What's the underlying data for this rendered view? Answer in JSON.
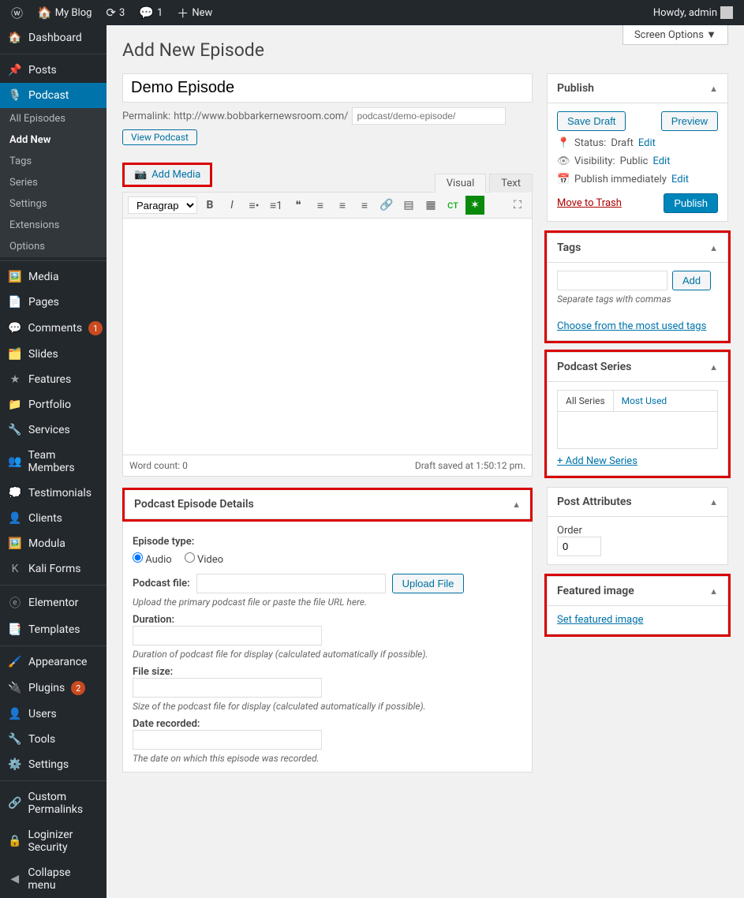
{
  "toolbar": {
    "site": "My Blog",
    "updates": "3",
    "comments": "1",
    "new": "New",
    "howdy": "Howdy, admin"
  },
  "screen_options": "Screen Options ▼",
  "page_title": "Add New Episode",
  "sidebar": {
    "items": [
      {
        "icon": "🏠",
        "label": "Dashboard"
      },
      {
        "icon": "📌",
        "label": "Posts"
      },
      {
        "icon": "🎙️",
        "label": "Podcast",
        "current": true
      },
      {
        "icon": "🖼️",
        "label": "Media"
      },
      {
        "icon": "📄",
        "label": "Pages"
      },
      {
        "icon": "💬",
        "label": "Comments",
        "badge": "1"
      },
      {
        "icon": "🗂️",
        "label": "Slides"
      },
      {
        "icon": "★",
        "label": "Features"
      },
      {
        "icon": "📁",
        "label": "Portfolio"
      },
      {
        "icon": "🔧",
        "label": "Services"
      },
      {
        "icon": "👥",
        "label": "Team Members"
      },
      {
        "icon": "💭",
        "label": "Testimonials"
      },
      {
        "icon": "👤",
        "label": "Clients"
      },
      {
        "icon": "🖼️",
        "label": "Modula"
      },
      {
        "icon": "K",
        "label": "Kali Forms"
      },
      {
        "icon": "ⓔ",
        "label": "Elementor"
      },
      {
        "icon": "📑",
        "label": "Templates"
      },
      {
        "icon": "🖌️",
        "label": "Appearance"
      },
      {
        "icon": "🔌",
        "label": "Plugins",
        "badge": "2"
      },
      {
        "icon": "👤",
        "label": "Users"
      },
      {
        "icon": "🔧",
        "label": "Tools"
      },
      {
        "icon": "⚙️",
        "label": "Settings"
      },
      {
        "icon": "🔗",
        "label": "Custom Permalinks"
      },
      {
        "icon": "🔒",
        "label": "Loginizer Security"
      },
      {
        "icon": "◀",
        "label": "Collapse menu"
      }
    ],
    "submenu": [
      "All Episodes",
      "Add New",
      "Tags",
      "Series",
      "Settings",
      "Extensions",
      "Options"
    ]
  },
  "title_value": "Demo Episode",
  "permalink": {
    "label": "Permalink:",
    "base": "http://www.bobbarkernewsroom.com/",
    "slug_placeholder": "podcast/demo-episode/",
    "view_btn": "View Podcast"
  },
  "add_media": "Add Media",
  "editor": {
    "visual": "Visual",
    "text": "Text",
    "paragraph": "Paragraph",
    "word_count_label": "Word count: 0",
    "draft_saved": "Draft saved at 1:50:12 pm."
  },
  "episode_details": {
    "title": "Podcast Episode Details",
    "type_label": "Episode type:",
    "audio": "Audio",
    "video": "Video",
    "file_label": "Podcast file:",
    "upload": "Upload File",
    "file_help": "Upload the primary podcast file or paste the file URL here.",
    "duration_label": "Duration:",
    "duration_help": "Duration of podcast file for display (calculated automatically if possible).",
    "size_label": "File size:",
    "size_help": "Size of the podcast file for display (calculated automatically if possible).",
    "date_label": "Date recorded:",
    "date_help": "The date on which this episode was recorded."
  },
  "publish": {
    "title": "Publish",
    "save_draft": "Save Draft",
    "preview": "Preview",
    "status_label": "Status:",
    "status_value": "Draft",
    "visibility_label": "Visibility:",
    "visibility_value": "Public",
    "schedule_label": "Publish immediately",
    "edit": "Edit",
    "trash": "Move to Trash",
    "publish_btn": "Publish"
  },
  "tags": {
    "title": "Tags",
    "add": "Add",
    "help": "Separate tags with commas",
    "choose": "Choose from the most used tags"
  },
  "series": {
    "title": "Podcast Series",
    "all": "All Series",
    "most": "Most Used",
    "add_new": "+ Add New Series"
  },
  "attrs": {
    "title": "Post Attributes",
    "order_label": "Order",
    "order_value": "0"
  },
  "featured": {
    "title": "Featured image",
    "set": "Set featured image"
  }
}
